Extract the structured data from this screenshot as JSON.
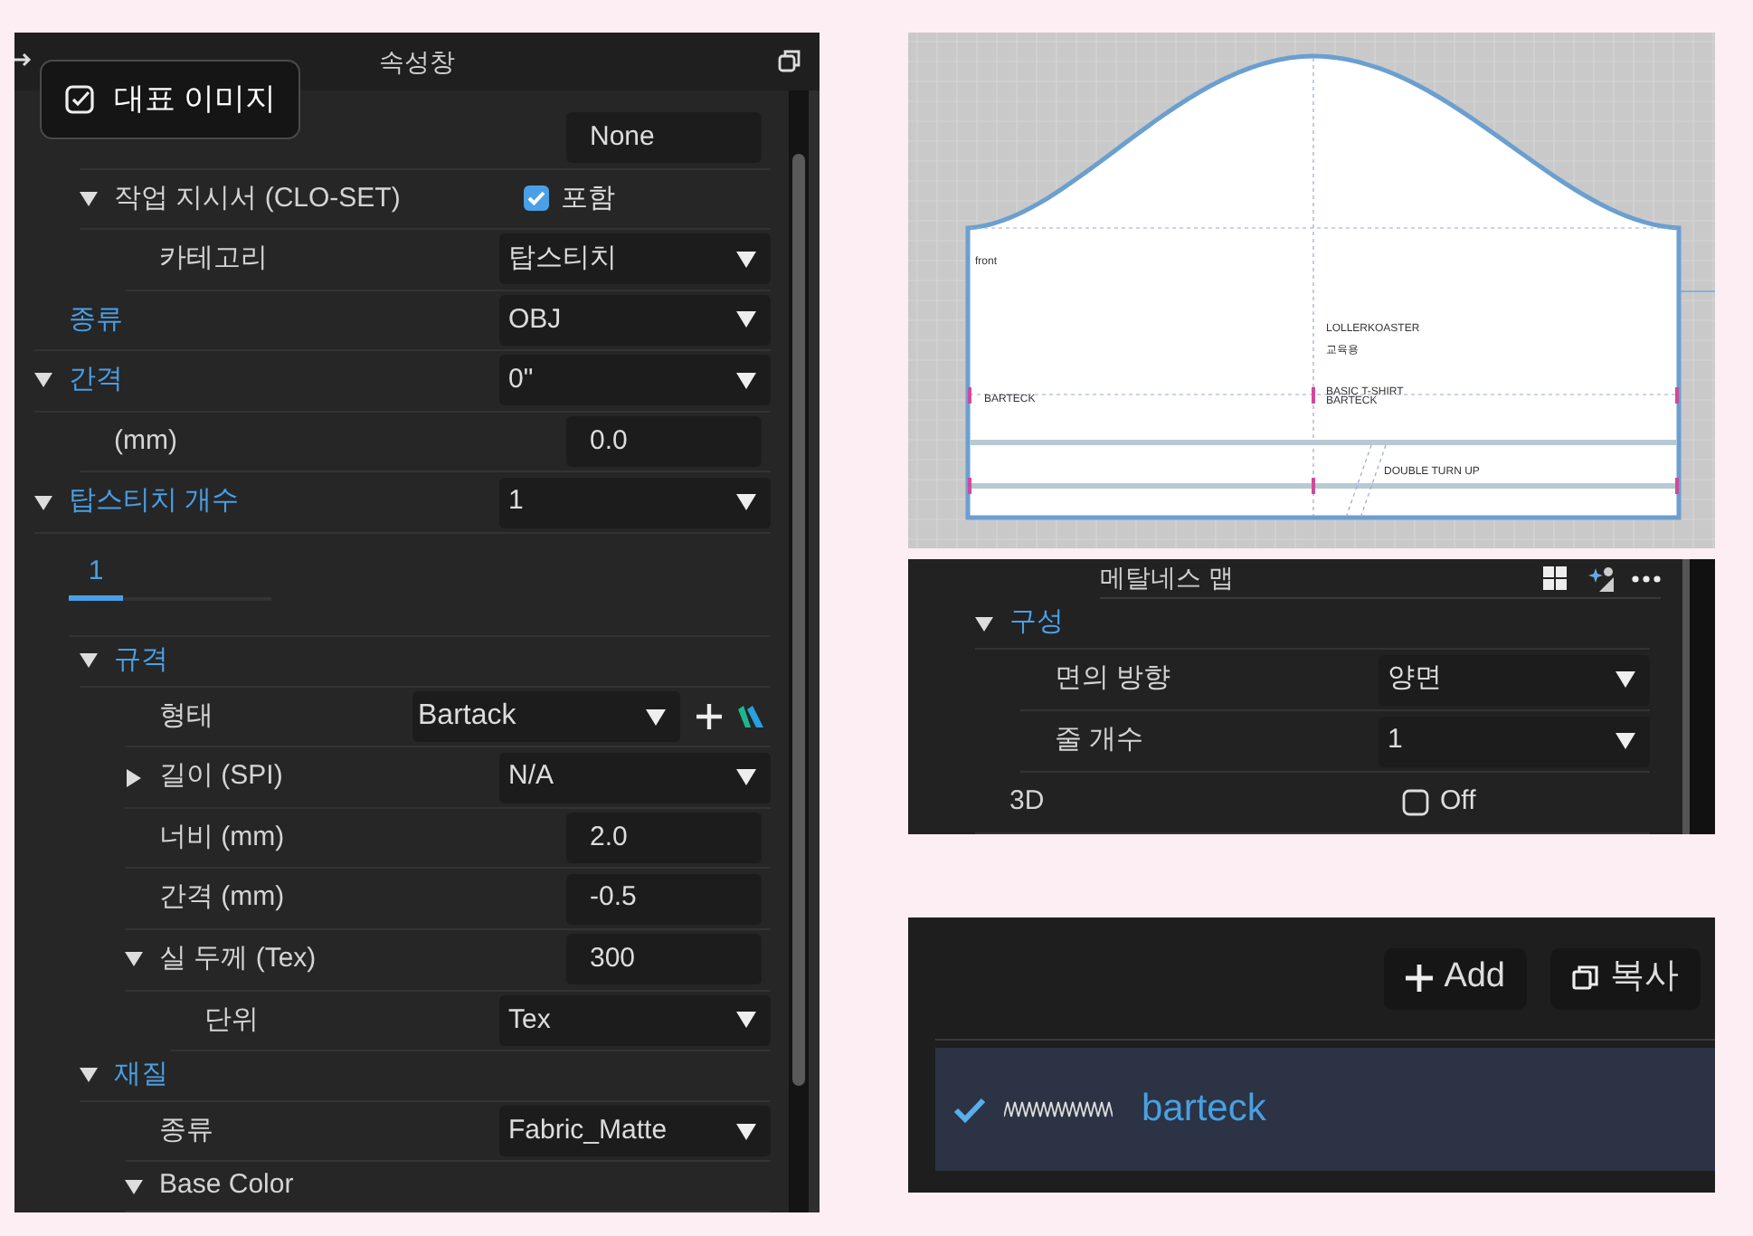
{
  "properties_panel": {
    "title": "속성창",
    "tooltip": {
      "label": "대표 이미지"
    },
    "rows": [
      {
        "kind": "continued",
        "children": [
          {
            "kind": "row",
            "control": {
              "kind": "field",
              "value": "None"
            }
          },
          {
            "kind": "row",
            "label": "작업 지시서 (CLO-SET)",
            "accent": false,
            "expanded": true,
            "control": {
              "kind": "checkbox",
              "checked": true,
              "value": "포함"
            },
            "children": [
              {
                "kind": "row",
                "label": "카테고리",
                "accent": false,
                "control": {
                  "kind": "dropdown",
                  "value": "탑스티치"
                }
              }
            ]
          }
        ]
      },
      {
        "kind": "row",
        "label": "종류",
        "accent": true,
        "control": {
          "kind": "dropdown",
          "value": "OBJ"
        }
      },
      {
        "kind": "row",
        "label": "간격",
        "accent": true,
        "expanded": true,
        "control": {
          "kind": "dropdown",
          "value": "0\""
        },
        "children": [
          {
            "kind": "row",
            "label": "(mm)",
            "accent": false,
            "control": {
              "kind": "field",
              "value": "0.0"
            }
          }
        ]
      },
      {
        "kind": "row",
        "label": "탑스티치 개수",
        "accent": true,
        "expanded": true,
        "control": {
          "kind": "dropdown",
          "value": "1"
        },
        "children": [
          {
            "kind": "tabs",
            "tabs": [
              {
                "label": "1",
                "selected": true
              }
            ]
          },
          {
            "kind": "row",
            "label": "규격",
            "accent": true,
            "expanded": true,
            "children": [
              {
                "kind": "row",
                "label": "형태",
                "accent": false,
                "control": {
                  "kind": "dropdown_add",
                  "value": "Bartack"
                }
              },
              {
                "kind": "row",
                "label": "길이 (SPI)",
                "accent": false,
                "expanded": false,
                "control": {
                  "kind": "dropdown",
                  "value": "N/A"
                }
              },
              {
                "kind": "row",
                "label": "너비 (mm)",
                "accent": false,
                "control": {
                  "kind": "field",
                  "value": "2.0"
                }
              },
              {
                "kind": "row",
                "label": "간격 (mm)",
                "accent": false,
                "control": {
                  "kind": "field",
                  "value": "-0.5"
                }
              },
              {
                "kind": "row",
                "label": "실 두께 (Tex)",
                "accent": false,
                "expanded": true,
                "control": {
                  "kind": "field",
                  "value": "300"
                },
                "children": [
                  {
                    "kind": "row",
                    "label": "단위",
                    "accent": false,
                    "control": {
                      "kind": "dropdown",
                      "value": "Tex"
                    }
                  }
                ]
              }
            ]
          },
          {
            "kind": "row",
            "label": "재질",
            "accent": true,
            "expanded": true,
            "children": [
              {
                "kind": "row",
                "label": "종류",
                "accent": false,
                "control": {
                  "kind": "dropdown",
                  "value": "Fabric_Matte"
                }
              },
              {
                "kind": "row",
                "label": "Base Color",
                "accent": false,
                "expanded": true
              }
            ]
          }
        ]
      }
    ]
  },
  "pattern_view": {
    "labels": [
      "front",
      "LOLLERKOASTER",
      "교육용",
      "BARTECK",
      "BASIC T-SHIRT",
      "BARTECK",
      "DOUBLE TURN UP"
    ]
  },
  "material_panel": {
    "header": "메탈네스 맵",
    "rows": [
      {
        "kind": "row",
        "label": "구성",
        "accent": true,
        "expanded": true,
        "children": [
          {
            "kind": "row",
            "label": "면의 방향",
            "accent": false,
            "control": {
              "kind": "dropdown",
              "value": "양면"
            }
          },
          {
            "kind": "row",
            "label": "줄 개수",
            "accent": false,
            "control": {
              "kind": "dropdown",
              "value": "1"
            }
          }
        ]
      },
      {
        "kind": "row",
        "label": "3D",
        "accent": false,
        "control": {
          "kind": "checkbox",
          "checked": false,
          "value": "Off"
        }
      }
    ]
  },
  "topstitch_list": {
    "buttons": [
      {
        "kind": "add",
        "label": "Add"
      },
      {
        "kind": "copy",
        "label": "복사"
      }
    ],
    "items": [
      {
        "name": "barteck",
        "selected": true,
        "checked": true
      }
    ]
  }
}
